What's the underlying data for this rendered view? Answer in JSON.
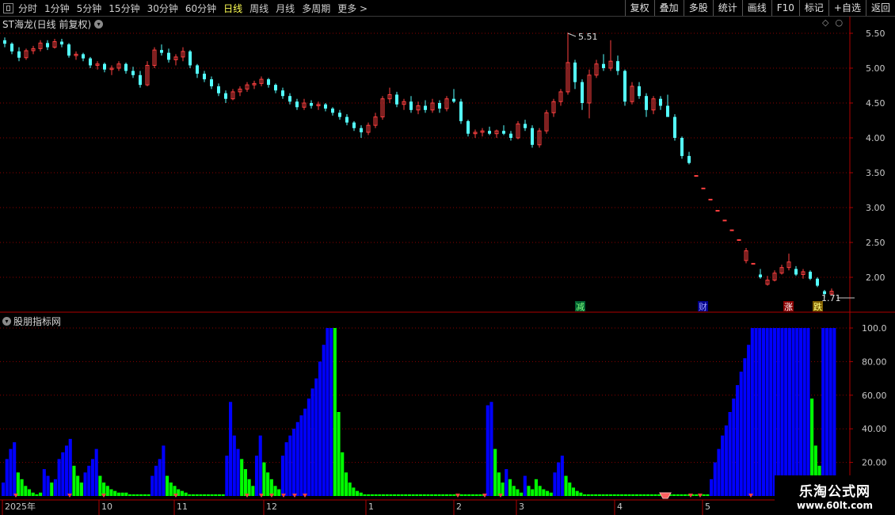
{
  "toolbar": {
    "left_items": [
      "分时",
      "1分钟",
      "5分钟",
      "15分钟",
      "30分钟",
      "60分钟",
      "日线",
      "周线",
      "月线",
      "多周期",
      "更多 >"
    ],
    "active": "日线",
    "right_items": [
      "复权",
      "叠加",
      "多股",
      "统计",
      "画线",
      "F10",
      "标记",
      "+自选",
      "返回"
    ]
  },
  "main_panel": {
    "title": "ST海龙(日线 前复权)",
    "high_label": "5.51",
    "low_label": "1.71",
    "price_ticks": [
      "5.50",
      "5.00",
      "4.50",
      "4.00",
      "3.50",
      "3.00",
      "2.50",
      "2.00"
    ],
    "markers": [
      "减",
      "财",
      "涨",
      "跌"
    ]
  },
  "sub_panel": {
    "title": "股朋指标网",
    "ticks": [
      "100.0",
      "80.00",
      "60.00",
      "40.00",
      "20.00"
    ]
  },
  "date_axis": [
    "2025年",
    "10",
    "11",
    "12",
    "1",
    "2",
    "3",
    "4",
    "5"
  ],
  "watermark": {
    "line1": "乐淘公式网",
    "line2": "www.60lt.com"
  },
  "colors": {
    "up": "#ff4040",
    "down": "#54ffff",
    "bar_blue": "#0000ff",
    "bar_green": "#00ff00",
    "grid": "#8b0000"
  },
  "chart_data": {
    "type": "bar",
    "candles": [
      [
        5.4,
        5.44,
        5.3,
        5.35
      ],
      [
        5.35,
        5.37,
        5.2,
        5.24
      ],
      [
        5.24,
        5.3,
        5.1,
        5.15
      ],
      [
        5.15,
        5.28,
        5.12,
        5.25
      ],
      [
        5.25,
        5.32,
        5.2,
        5.28
      ],
      [
        5.28,
        5.4,
        5.24,
        5.36
      ],
      [
        5.36,
        5.4,
        5.26,
        5.3
      ],
      [
        5.3,
        5.42,
        5.28,
        5.38
      ],
      [
        5.38,
        5.42,
        5.3,
        5.34
      ],
      [
        5.34,
        5.36,
        5.15,
        5.18
      ],
      [
        5.18,
        5.24,
        5.12,
        5.2
      ],
      [
        5.2,
        5.22,
        5.1,
        5.14
      ],
      [
        5.14,
        5.16,
        5.0,
        5.04
      ],
      [
        5.04,
        5.1,
        4.98,
        5.06
      ],
      [
        5.06,
        5.08,
        4.94,
        4.98
      ],
      [
        4.98,
        5.04,
        4.9,
        5.0
      ],
      [
        5.0,
        5.1,
        4.96,
        5.06
      ],
      [
        5.06,
        5.08,
        4.92,
        4.96
      ],
      [
        4.96,
        5.02,
        4.86,
        4.9
      ],
      [
        4.9,
        4.96,
        4.72,
        4.76
      ],
      [
        4.76,
        5.1,
        4.74,
        5.04
      ],
      [
        5.04,
        5.3,
        5.0,
        5.26
      ],
      [
        5.26,
        5.34,
        5.18,
        5.22
      ],
      [
        5.22,
        5.28,
        5.08,
        5.12
      ],
      [
        5.12,
        5.2,
        5.04,
        5.16
      ],
      [
        5.16,
        5.3,
        5.1,
        5.24
      ],
      [
        5.24,
        5.26,
        5.0,
        5.04
      ],
      [
        5.04,
        5.06,
        4.86,
        4.92
      ],
      [
        4.92,
        4.96,
        4.8,
        4.84
      ],
      [
        4.84,
        4.88,
        4.7,
        4.74
      ],
      [
        4.74,
        4.78,
        4.6,
        4.64
      ],
      [
        4.64,
        4.68,
        4.5,
        4.56
      ],
      [
        4.56,
        4.7,
        4.54,
        4.66
      ],
      [
        4.66,
        4.74,
        4.6,
        4.7
      ],
      [
        4.7,
        4.8,
        4.66,
        4.76
      ],
      [
        4.76,
        4.82,
        4.7,
        4.78
      ],
      [
        4.78,
        4.88,
        4.74,
        4.84
      ],
      [
        4.84,
        4.86,
        4.72,
        4.76
      ],
      [
        4.76,
        4.78,
        4.64,
        4.68
      ],
      [
        4.68,
        4.72,
        4.56,
        4.6
      ],
      [
        4.6,
        4.64,
        4.48,
        4.52
      ],
      [
        4.52,
        4.56,
        4.4,
        4.44
      ],
      [
        4.44,
        4.56,
        4.4,
        4.5
      ],
      [
        4.5,
        4.54,
        4.42,
        4.46
      ],
      [
        4.46,
        4.52,
        4.4,
        4.48
      ],
      [
        4.48,
        4.5,
        4.38,
        4.42
      ],
      [
        4.42,
        4.44,
        4.32,
        4.36
      ],
      [
        4.36,
        4.4,
        4.26,
        4.3
      ],
      [
        4.3,
        4.34,
        4.18,
        4.22
      ],
      [
        4.22,
        4.24,
        4.1,
        4.14
      ],
      [
        4.14,
        4.18,
        4.0,
        4.08
      ],
      [
        4.08,
        4.22,
        4.04,
        4.18
      ],
      [
        4.18,
        4.36,
        4.14,
        4.3
      ],
      [
        4.3,
        4.6,
        4.26,
        4.56
      ],
      [
        4.56,
        4.72,
        4.5,
        4.62
      ],
      [
        4.62,
        4.66,
        4.44,
        4.48
      ],
      [
        4.48,
        4.56,
        4.4,
        4.52
      ],
      [
        4.52,
        4.6,
        4.36,
        4.4
      ],
      [
        4.4,
        4.52,
        4.34,
        4.46
      ],
      [
        4.46,
        4.54,
        4.36,
        4.4
      ],
      [
        4.4,
        4.56,
        4.36,
        4.5
      ],
      [
        4.5,
        4.54,
        4.36,
        4.42
      ],
      [
        4.42,
        4.6,
        4.38,
        4.56
      ],
      [
        4.56,
        4.7,
        4.5,
        4.52
      ],
      [
        4.52,
        4.56,
        4.2,
        4.24
      ],
      [
        4.24,
        4.26,
        4.02,
        4.06
      ],
      [
        4.06,
        4.12,
        4.0,
        4.08
      ],
      [
        4.08,
        4.14,
        4.02,
        4.1
      ],
      [
        4.1,
        4.16,
        4.04,
        4.06
      ],
      [
        4.06,
        4.12,
        4.0,
        4.1
      ],
      [
        4.1,
        4.18,
        4.04,
        4.06
      ],
      [
        4.06,
        4.1,
        3.96,
        4.0
      ],
      [
        4.0,
        4.24,
        3.98,
        4.2
      ],
      [
        4.2,
        4.26,
        4.1,
        4.14
      ],
      [
        4.14,
        4.18,
        3.86,
        3.9
      ],
      [
        3.9,
        4.14,
        3.86,
        4.1
      ],
      [
        4.1,
        4.4,
        4.06,
        4.36
      ],
      [
        4.36,
        4.56,
        4.3,
        4.52
      ],
      [
        4.52,
        4.7,
        4.46,
        4.66
      ],
      [
        4.66,
        5.51,
        4.62,
        5.08
      ],
      [
        5.08,
        5.12,
        4.7,
        4.8
      ],
      [
        4.8,
        4.84,
        4.4,
        4.5
      ],
      [
        4.5,
        4.98,
        4.28,
        4.9
      ],
      [
        4.9,
        5.12,
        4.86,
        5.06
      ],
      [
        5.06,
        5.2,
        4.96,
        5.0
      ],
      [
        5.0,
        5.4,
        4.96,
        5.1
      ],
      [
        5.1,
        5.18,
        4.9,
        4.96
      ],
      [
        4.96,
        4.98,
        4.46,
        4.52
      ],
      [
        4.52,
        4.8,
        4.48,
        4.74
      ],
      [
        4.74,
        4.8,
        4.56,
        4.6
      ],
      [
        4.6,
        4.64,
        4.3,
        4.4
      ],
      [
        4.4,
        4.6,
        4.34,
        4.56
      ],
      [
        4.56,
        4.6,
        4.4,
        4.46
      ],
      [
        4.46,
        4.62,
        4.42,
        4.3
      ],
      [
        4.3,
        4.34,
        3.96,
        4.0
      ],
      [
        4.0,
        4.02,
        3.7,
        3.74
      ],
      [
        3.74,
        3.8,
        3.62,
        3.64
      ],
      [
        3.46,
        3.46,
        3.46,
        3.46
      ],
      [
        3.28,
        3.28,
        3.28,
        3.28
      ],
      [
        3.12,
        3.12,
        3.12,
        3.12
      ],
      [
        2.96,
        2.96,
        2.96,
        2.96
      ],
      [
        2.82,
        2.82,
        2.82,
        2.82
      ],
      [
        2.68,
        2.68,
        2.68,
        2.68
      ],
      [
        2.54,
        2.54,
        2.54,
        2.54
      ],
      [
        2.24,
        2.42,
        2.2,
        2.38
      ],
      [
        2.2,
        2.2,
        2.2,
        2.2
      ],
      [
        2.04,
        2.12,
        1.98,
        2.0
      ],
      [
        1.9,
        2.02,
        1.88,
        1.96
      ],
      [
        1.96,
        2.1,
        1.94,
        2.06
      ],
      [
        2.06,
        2.18,
        2.04,
        2.14
      ],
      [
        2.14,
        2.34,
        2.1,
        2.22
      ],
      [
        2.12,
        2.16,
        2.02,
        2.04
      ],
      [
        2.04,
        2.12,
        1.98,
        2.08
      ],
      [
        2.08,
        2.1,
        1.96,
        1.98
      ],
      [
        1.98,
        2.0,
        1.86,
        1.88
      ],
      [
        1.8,
        1.82,
        1.71,
        1.76
      ],
      [
        1.76,
        1.84,
        1.74,
        1.8
      ]
    ],
    "indicator": [
      [
        8,
        "b"
      ],
      [
        22,
        "b"
      ],
      [
        28,
        "b"
      ],
      [
        32,
        "b"
      ],
      [
        14,
        "g"
      ],
      [
        10,
        "g"
      ],
      [
        6,
        "g"
      ],
      [
        4,
        "g"
      ],
      [
        2,
        "g"
      ],
      [
        1,
        "g"
      ],
      [
        2,
        "g"
      ],
      [
        16,
        "b"
      ],
      [
        12,
        "b"
      ],
      [
        8,
        "g"
      ],
      [
        10,
        "b"
      ],
      [
        22,
        "b"
      ],
      [
        26,
        "b"
      ],
      [
        30,
        "b"
      ],
      [
        34,
        "b"
      ],
      [
        18,
        "g"
      ],
      [
        12,
        "g"
      ],
      [
        8,
        "g"
      ],
      [
        14,
        "b"
      ],
      [
        18,
        "b"
      ],
      [
        22,
        "b"
      ],
      [
        28,
        "b"
      ],
      [
        12,
        "g"
      ],
      [
        8,
        "g"
      ],
      [
        6,
        "g"
      ],
      [
        4,
        "g"
      ],
      [
        3,
        "g"
      ],
      [
        2,
        "g"
      ],
      [
        2,
        "g"
      ],
      [
        2,
        "g"
      ],
      [
        1,
        "g"
      ],
      [
        1,
        "g"
      ],
      [
        1,
        "g"
      ],
      [
        1,
        "g"
      ],
      [
        1,
        "g"
      ],
      [
        1,
        "g"
      ],
      [
        12,
        "b"
      ],
      [
        18,
        "b"
      ],
      [
        22,
        "b"
      ],
      [
        30,
        "b"
      ],
      [
        12,
        "g"
      ],
      [
        8,
        "g"
      ],
      [
        6,
        "g"
      ],
      [
        4,
        "g"
      ],
      [
        3,
        "g"
      ],
      [
        2,
        "g"
      ],
      [
        1,
        "g"
      ],
      [
        1,
        "g"
      ],
      [
        1,
        "g"
      ],
      [
        1,
        "g"
      ],
      [
        1,
        "g"
      ],
      [
        1,
        "g"
      ],
      [
        1,
        "g"
      ],
      [
        1,
        "g"
      ],
      [
        1,
        "g"
      ],
      [
        1,
        "g"
      ],
      [
        24,
        "b"
      ],
      [
        56,
        "b"
      ],
      [
        36,
        "b"
      ],
      [
        28,
        "b"
      ],
      [
        22,
        "g"
      ],
      [
        16,
        "g"
      ],
      [
        10,
        "g"
      ],
      [
        6,
        "g"
      ],
      [
        24,
        "b"
      ],
      [
        36,
        "b"
      ],
      [
        20,
        "g"
      ],
      [
        14,
        "g"
      ],
      [
        10,
        "g"
      ],
      [
        6,
        "g"
      ],
      [
        4,
        "g"
      ],
      [
        24,
        "b"
      ],
      [
        32,
        "b"
      ],
      [
        36,
        "b"
      ],
      [
        40,
        "b"
      ],
      [
        44,
        "b"
      ],
      [
        48,
        "b"
      ],
      [
        52,
        "b"
      ],
      [
        58,
        "b"
      ],
      [
        64,
        "b"
      ],
      [
        70,
        "b"
      ],
      [
        80,
        "b"
      ],
      [
        90,
        "b"
      ],
      [
        100,
        "b"
      ],
      [
        100,
        "b"
      ],
      [
        100,
        "g"
      ],
      [
        50,
        "g"
      ],
      [
        26,
        "g"
      ],
      [
        14,
        "g"
      ],
      [
        8,
        "g"
      ],
      [
        5,
        "g"
      ],
      [
        3,
        "g"
      ],
      [
        2,
        "g"
      ],
      [
        1,
        "g"
      ],
      [
        1,
        "g"
      ],
      [
        1,
        "g"
      ],
      [
        1,
        "g"
      ],
      [
        1,
        "g"
      ],
      [
        1,
        "g"
      ],
      [
        1,
        "g"
      ],
      [
        1,
        "g"
      ],
      [
        1,
        "g"
      ],
      [
        1,
        "g"
      ],
      [
        1,
        "g"
      ],
      [
        1,
        "g"
      ],
      [
        1,
        "g"
      ],
      [
        1,
        "g"
      ],
      [
        1,
        "g"
      ],
      [
        1,
        "g"
      ],
      [
        1,
        "g"
      ],
      [
        1,
        "g"
      ],
      [
        1,
        "g"
      ],
      [
        1,
        "g"
      ],
      [
        1,
        "g"
      ],
      [
        1,
        "g"
      ],
      [
        1,
        "g"
      ],
      [
        1,
        "g"
      ],
      [
        1,
        "g"
      ],
      [
        1,
        "g"
      ],
      [
        1,
        "g"
      ],
      [
        1,
        "g"
      ],
      [
        1,
        "g"
      ],
      [
        1,
        "g"
      ],
      [
        1,
        "g"
      ],
      [
        1,
        "g"
      ],
      [
        1,
        "g"
      ],
      [
        54,
        "b"
      ],
      [
        56,
        "b"
      ],
      [
        28,
        "g"
      ],
      [
        14,
        "g"
      ],
      [
        8,
        "g"
      ],
      [
        16,
        "b"
      ],
      [
        10,
        "g"
      ],
      [
        6,
        "g"
      ],
      [
        4,
        "g"
      ],
      [
        2,
        "g"
      ],
      [
        12,
        "b"
      ],
      [
        6,
        "g"
      ],
      [
        4,
        "g"
      ],
      [
        10,
        "g"
      ],
      [
        6,
        "g"
      ],
      [
        4,
        "g"
      ],
      [
        3,
        "g"
      ],
      [
        2,
        "g"
      ],
      [
        14,
        "b"
      ],
      [
        20,
        "b"
      ],
      [
        24,
        "b"
      ],
      [
        12,
        "g"
      ],
      [
        8,
        "g"
      ],
      [
        5,
        "g"
      ],
      [
        3,
        "g"
      ],
      [
        2,
        "g"
      ],
      [
        1,
        "g"
      ],
      [
        1,
        "g"
      ],
      [
        1,
        "g"
      ],
      [
        1,
        "g"
      ],
      [
        1,
        "g"
      ],
      [
        1,
        "g"
      ],
      [
        1,
        "g"
      ],
      [
        1,
        "g"
      ],
      [
        1,
        "g"
      ],
      [
        1,
        "g"
      ],
      [
        1,
        "g"
      ],
      [
        1,
        "g"
      ],
      [
        1,
        "g"
      ],
      [
        1,
        "g"
      ],
      [
        1,
        "g"
      ],
      [
        1,
        "g"
      ],
      [
        1,
        "g"
      ],
      [
        1,
        "g"
      ],
      [
        1,
        "g"
      ],
      [
        1,
        "g"
      ],
      [
        1,
        "g"
      ],
      [
        1,
        "g"
      ],
      [
        1,
        "g"
      ],
      [
        1,
        "g"
      ],
      [
        1,
        "g"
      ],
      [
        1,
        "g"
      ],
      [
        1,
        "g"
      ],
      [
        1,
        "g"
      ],
      [
        1,
        "g"
      ],
      [
        1,
        "g"
      ],
      [
        1,
        "g"
      ],
      [
        1,
        "g"
      ],
      [
        1,
        "g"
      ],
      [
        1,
        "g"
      ],
      [
        10,
        "b"
      ],
      [
        20,
        "b"
      ],
      [
        28,
        "b"
      ],
      [
        36,
        "b"
      ],
      [
        42,
        "b"
      ],
      [
        50,
        "b"
      ],
      [
        58,
        "b"
      ],
      [
        66,
        "b"
      ],
      [
        74,
        "b"
      ],
      [
        82,
        "b"
      ],
      [
        90,
        "b"
      ],
      [
        100,
        "b"
      ],
      [
        100,
        "b"
      ],
      [
        100,
        "b"
      ],
      [
        100,
        "b"
      ],
      [
        100,
        "b"
      ],
      [
        100,
        "b"
      ],
      [
        100,
        "b"
      ],
      [
        100,
        "b"
      ],
      [
        100,
        "b"
      ],
      [
        100,
        "b"
      ],
      [
        100,
        "b"
      ],
      [
        100,
        "b"
      ],
      [
        100,
        "b"
      ],
      [
        100,
        "b"
      ],
      [
        100,
        "b"
      ],
      [
        100,
        "b"
      ],
      [
        58,
        "g"
      ],
      [
        30,
        "g"
      ],
      [
        18,
        "g"
      ],
      [
        100,
        "b"
      ],
      [
        100,
        "b"
      ],
      [
        100,
        "b"
      ],
      [
        100,
        "b"
      ]
    ],
    "ylim": [
      1.6,
      5.6
    ],
    "indicator_ylim": [
      0,
      100
    ]
  }
}
